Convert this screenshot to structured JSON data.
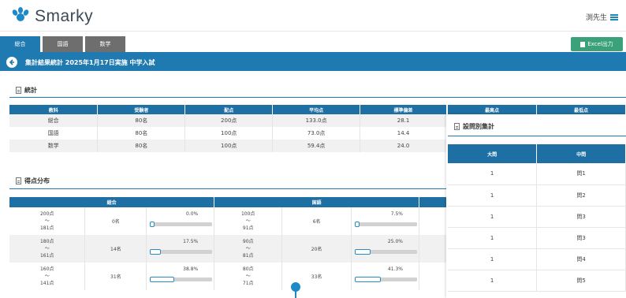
{
  "app": {
    "logo_text": "Smarky",
    "user_label": "渕先生"
  },
  "tabs": [
    {
      "label": "総合",
      "active": true
    },
    {
      "label": "国語",
      "active": false
    },
    {
      "label": "数学",
      "active": false
    }
  ],
  "toolbar": {
    "excel_label": "Excel出力"
  },
  "page": {
    "title": "集計結果統計 2025年1月17日実施 中学入試"
  },
  "stats": {
    "heading": "統計",
    "columns": [
      "教科",
      "受験者",
      "配点",
      "平均点",
      "標準偏差",
      "最高点",
      "最低点"
    ],
    "rows": [
      [
        "総合",
        "80名",
        "200点",
        "133.0点",
        "28.1"
      ],
      [
        "国語",
        "80名",
        "100点",
        "73.0点",
        "14.4"
      ],
      [
        "数学",
        "80名",
        "100点",
        "59.4点",
        "24.0"
      ]
    ]
  },
  "question_summary": {
    "heading": "設問別集計",
    "columns": [
      "大問",
      "中問"
    ],
    "rows": [
      [
        "1",
        "問1"
      ],
      [
        "1",
        "問2"
      ],
      [
        "1",
        "問3"
      ],
      [
        "1",
        "問3"
      ],
      [
        "1",
        "問4"
      ],
      [
        "1",
        "問5"
      ]
    ]
  },
  "distribution": {
    "heading": "得点分布",
    "groups": [
      "総合",
      "国語"
    ],
    "rows": [
      {
        "s_hi": "200点",
        "s_tilde": "〜",
        "s_lo": "181点",
        "s_count": "0名",
        "s_pct": "0.0%",
        "s_value": 0.0,
        "k_hi": "100点",
        "k_tilde": "〜",
        "k_lo": "91点",
        "k_count": "6名",
        "k_pct": "7.5%",
        "k_value": 7.5
      },
      {
        "s_hi": "180点",
        "s_tilde": "〜",
        "s_lo": "161点",
        "s_count": "14名",
        "s_pct": "17.5%",
        "s_value": 17.5,
        "k_hi": "90点",
        "k_tilde": "〜",
        "k_lo": "81点",
        "k_count": "20名",
        "k_pct": "25.0%",
        "k_value": 25.0
      },
      {
        "s_hi": "160点",
        "s_tilde": "〜",
        "s_lo": "141点",
        "s_count": "31名",
        "s_pct": "38.8%",
        "s_value": 38.8,
        "k_hi": "80点",
        "k_tilde": "〜",
        "k_lo": "71点",
        "k_count": "33名",
        "k_pct": "41.3%",
        "k_value": 41.3
      }
    ]
  },
  "colors": {
    "primary": "#1e7ab0",
    "header_cell": "#1e6fa3",
    "excel": "#3aa17a",
    "tab_inactive": "#6e6e6e"
  },
  "icons": {
    "logo": "smarky-logo-icon",
    "menu": "hamburger-icon",
    "back": "back-arrow-icon",
    "doc": "document-icon",
    "excel": "file-icon"
  }
}
